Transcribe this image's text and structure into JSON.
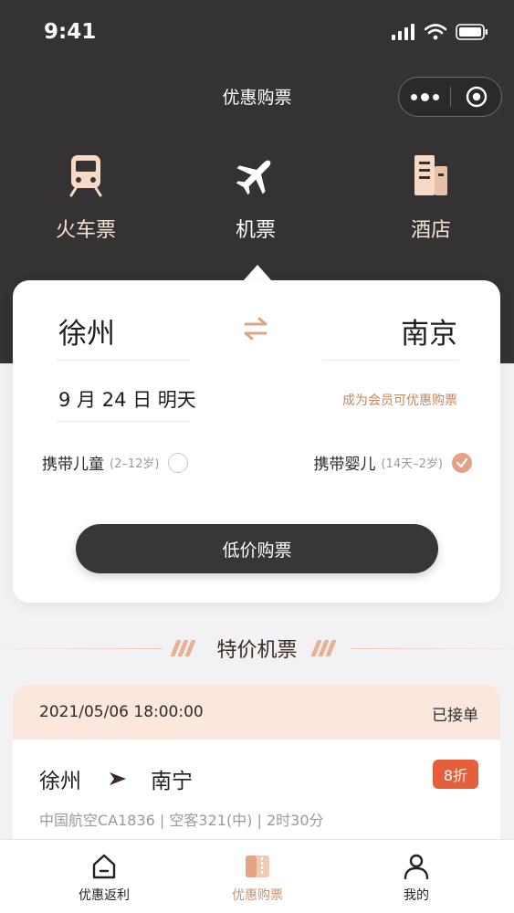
{
  "status_bar": {
    "time": "9:41"
  },
  "nav": {
    "title": "优惠购票"
  },
  "categories": [
    {
      "label": "火车票",
      "icon": "train-icon"
    },
    {
      "label": "机票",
      "icon": "airplane-icon",
      "active": true
    },
    {
      "label": "酒店",
      "icon": "hotel-icon"
    }
  ],
  "search": {
    "from_city": "徐州",
    "to_city": "南京",
    "date": "9 月 24 日  明天",
    "member_tip": "成为会员可优惠购票",
    "child_option": {
      "label": "携带儿童",
      "sub": "(2–12岁)",
      "checked": false
    },
    "infant_option": {
      "label": "携带婴儿",
      "sub": "(14天–2岁)",
      "checked": true
    },
    "button_label": "低价购票"
  },
  "section": {
    "title": "特价机票"
  },
  "ticket": {
    "datetime": "2021/05/06 18:00:00",
    "status": "已接单",
    "from": "徐州",
    "to": "南宁",
    "discount": "8折",
    "info": "中国航空CA1836 | 空客321(中) | 2时30分"
  },
  "tabs": [
    {
      "label": "优惠返利",
      "icon": "home-icon"
    },
    {
      "label": "优惠购票",
      "icon": "ticket-icon",
      "active": true
    },
    {
      "label": "我的",
      "icon": "user-icon"
    }
  ],
  "colors": {
    "header_bg": "#343233",
    "accent": "#c9926f",
    "discount_badge": "#e4603c",
    "ticket_head_bg": "#fbe7dc"
  }
}
